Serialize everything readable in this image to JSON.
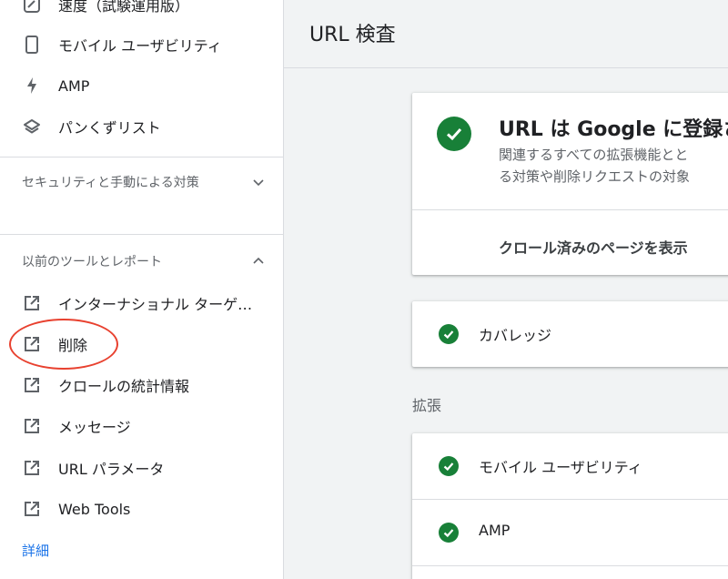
{
  "sidebar": {
    "items_top": [
      {
        "label": "速度（試験運用版）",
        "icon": "gauge-icon"
      },
      {
        "label": "モバイル ユーザビリティ",
        "icon": "smartphone-icon"
      },
      {
        "label": "AMP",
        "icon": "lightning-icon"
      },
      {
        "label": "パンくずリスト",
        "icon": "layers-icon"
      }
    ],
    "section_security": {
      "label": "セキュリティと手動による対策",
      "icon": "chevron-down-icon"
    },
    "section_legacy": {
      "label": "以前のツールとレポート",
      "icon": "chevron-up-icon"
    },
    "legacy_items": [
      {
        "label": "インターナショナル ターゲ…",
        "icon": "open-in-new-icon"
      },
      {
        "label": "削除",
        "icon": "open-in-new-icon"
      },
      {
        "label": "クロールの統計情報",
        "icon": "open-in-new-icon"
      },
      {
        "label": "メッセージ",
        "icon": "open-in-new-icon"
      },
      {
        "label": "URL パラメータ",
        "icon": "open-in-new-icon"
      },
      {
        "label": "Web Tools",
        "icon": "open-in-new-icon"
      }
    ],
    "more_label": "詳細"
  },
  "header": {
    "title": "URL 検査"
  },
  "status_card": {
    "title": "URL は Google に登録さ",
    "desc_line1": "関連するすべての拡張機能とと",
    "desc_line2": "る対策や削除リクエストの対象",
    "link_label": "クロール済みのページを表示",
    "icon": "check-circle-icon"
  },
  "coverage": {
    "label": "カバレッジ",
    "icon": "check-circle-icon"
  },
  "enhancements": {
    "heading": "拡張",
    "items": [
      {
        "label": "モバイル ユーザビリティ",
        "icon": "check-circle-icon"
      },
      {
        "label": "AMP",
        "icon": "check-circle-icon"
      }
    ]
  },
  "colors": {
    "accent_green": "#188038",
    "link_blue": "#1a73e8",
    "annotation_red": "#e8412f"
  }
}
